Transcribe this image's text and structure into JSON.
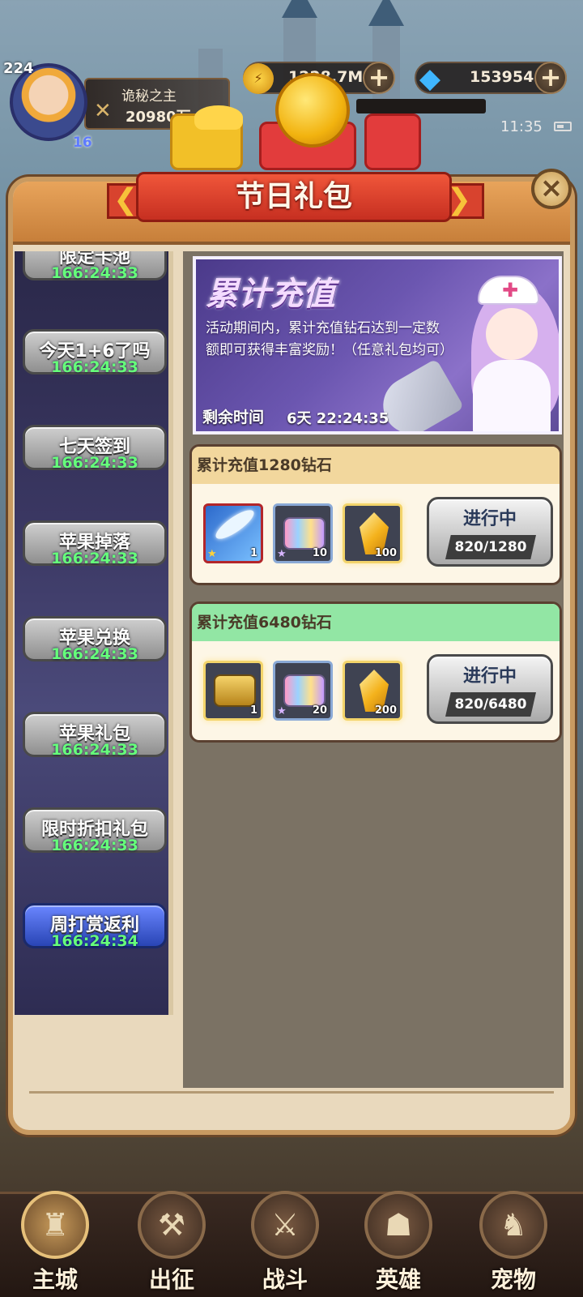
{
  "hud": {
    "player_level": "224",
    "vip_level": "16",
    "player_name": "诡秘之主",
    "player_power": "20980万",
    "gold_value": "1228.7M",
    "gem_value": "153954",
    "time": "11:35"
  },
  "popup": {
    "title": "节日礼包"
  },
  "sidebar": {
    "items": [
      {
        "label": "限定卡池",
        "time": "166:24:33",
        "active": false
      },
      {
        "label": "今天1+6了吗",
        "time": "166:24:33",
        "active": false
      },
      {
        "label": "七天签到",
        "time": "166:24:33",
        "active": false
      },
      {
        "label": "苹果掉落",
        "time": "166:24:33",
        "active": false
      },
      {
        "label": "苹果兑换",
        "time": "166:24:33",
        "active": false
      },
      {
        "label": "苹果礼包",
        "time": "166:24:33",
        "active": false
      },
      {
        "label": "限时折扣礼包",
        "time": "166:24:33",
        "active": false
      },
      {
        "label": "周打赏返利",
        "time": "166:24:34",
        "active": true
      }
    ]
  },
  "banner": {
    "title": "累计充值",
    "description": "活动期间内，累计充值钻石达到一定数额即可获得丰富奖励！（任意礼包均可）",
    "remain_label": "剩余时间",
    "remain_value": "6天 22:24:35"
  },
  "rewards": [
    {
      "title": "累计充值1280钻石",
      "status": "进行中",
      "progress": "820/1280",
      "items": [
        {
          "icon": "feather-icon",
          "count": "1"
        },
        {
          "icon": "crystal-chest-icon",
          "count": "10"
        },
        {
          "icon": "gold-crystal-icon",
          "count": "100"
        }
      ]
    },
    {
      "title": "累计充值6480钻石",
      "status": "进行中",
      "progress": "820/6480",
      "items": [
        {
          "icon": "gold-chest-icon",
          "count": "1"
        },
        {
          "icon": "crystal-chest-icon",
          "count": "20"
        },
        {
          "icon": "gold-crystal-icon",
          "count": "200"
        }
      ]
    }
  ],
  "bottom_nav": [
    {
      "label": "主城",
      "icon": "castle-icon"
    },
    {
      "label": "出征",
      "icon": "crossed-axes-icon"
    },
    {
      "label": "战斗",
      "icon": "battle-shield-icon"
    },
    {
      "label": "英雄",
      "icon": "hooded-hero-icon"
    },
    {
      "label": "宠物",
      "icon": "dragon-pet-icon"
    }
  ]
}
